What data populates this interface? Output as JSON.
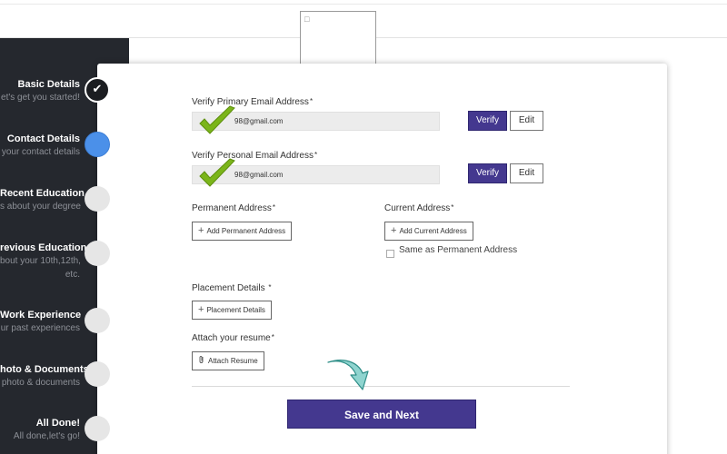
{
  "sidebar": {
    "steps": [
      {
        "title": "Basic Details",
        "subtitle": "et's get you started!",
        "state": "done"
      },
      {
        "title": "Contact Details",
        "subtitle": "your contact details",
        "state": "active"
      },
      {
        "title": "Recent Education",
        "subtitle": "s about your degree",
        "state": "pending"
      },
      {
        "title": "revious Education",
        "subtitle": "bout your 10th,12th,",
        "subtitle2": "etc.",
        "state": "pending"
      },
      {
        "title": "Work Experience",
        "subtitle": "ur past experiences",
        "state": "pending"
      },
      {
        "title": "hoto & Documents",
        "subtitle": "photo & documents",
        "state": "pending"
      },
      {
        "title": "All Done!",
        "subtitle": "All done,let's go!",
        "state": "pending"
      }
    ],
    "done_icon": "checkmark-icon"
  },
  "form": {
    "primary_email": {
      "label": "Verify Primary Email Address",
      "required": "*",
      "value": "98@gmail.com",
      "verify_label": "Verify",
      "edit_label": "Edit"
    },
    "personal_email": {
      "label": "Verify Personal Email Address",
      "required": "*",
      "value": "98@gmail.com",
      "verify_label": "Verify",
      "edit_label": "Edit"
    },
    "permanent_address": {
      "label": "Permanent Address",
      "required": "*",
      "button_label": "Add Permanent Address"
    },
    "current_address": {
      "label": "Current Address",
      "required": "*",
      "button_label": "Add Current Address"
    },
    "same_as_permanent": {
      "label": "Same as Permanent Address",
      "checked": false
    },
    "placement": {
      "label": "Placement Details ",
      "required": "*",
      "button_label": "Placement Details"
    },
    "resume": {
      "label": "Attach your resume",
      "required": "*",
      "button_label": "Attach Resume"
    },
    "save_label": "Save and Next"
  },
  "colors": {
    "sidebar_bg": "#25282e",
    "accent_purple": "#44388f",
    "active_step_blue": "#4b90e9",
    "check_green": "#7bb51a",
    "arrow_teal": "#8fd4cf"
  },
  "icons": {
    "plus": "+",
    "paperclip": "paperclip-icon",
    "broken_image": "broken-image-icon"
  }
}
